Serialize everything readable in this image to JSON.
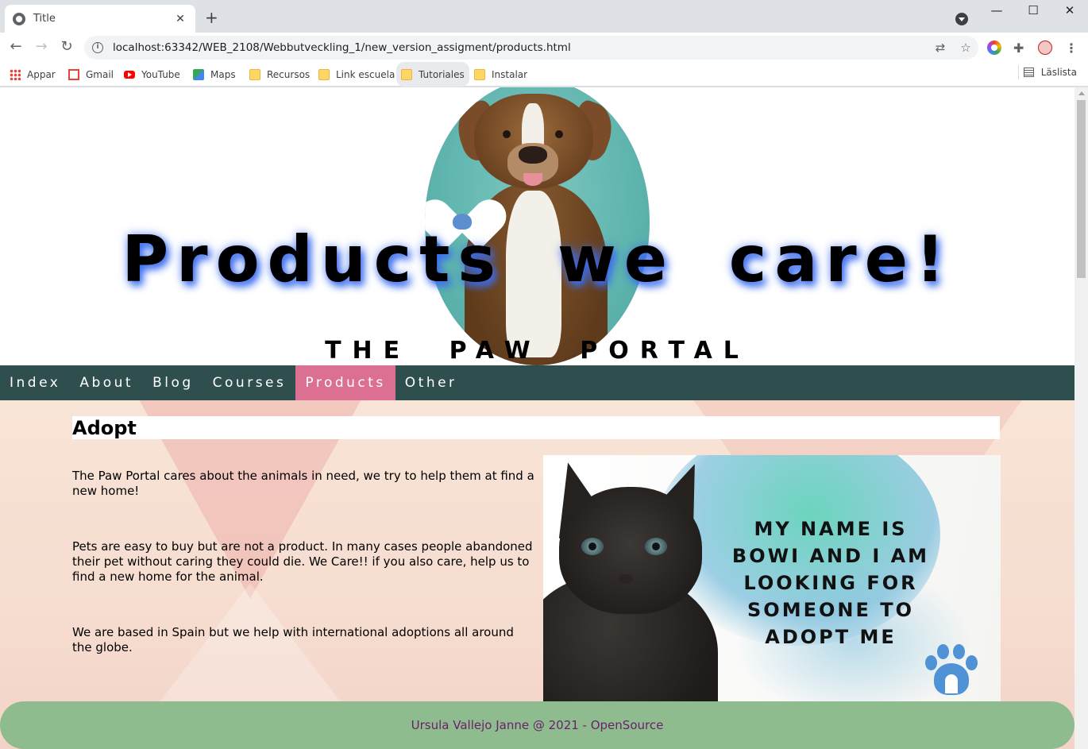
{
  "browser": {
    "tab_title": "Title",
    "new_tab": "+",
    "tab_close": "✕",
    "url": "localhost:63342/WEB_2108/Webbutveckling_1/new_version_assigment/products.html",
    "window_controls": {
      "minimize": "—",
      "maximize": "☐",
      "close": "✕"
    },
    "nav": {
      "back": "←",
      "forward": "→",
      "reload": "↻"
    }
  },
  "bookmarks": {
    "items": [
      {
        "label": "Appar",
        "icon": "apps-grid-icon"
      },
      {
        "label": "Gmail",
        "icon": "gmail-icon"
      },
      {
        "label": "YouTube",
        "icon": "youtube-icon"
      },
      {
        "label": "Maps",
        "icon": "maps-icon"
      },
      {
        "label": "Recursos",
        "icon": "folder-icon"
      },
      {
        "label": "Link escuela",
        "icon": "folder-icon"
      },
      {
        "label": "Tutoriales",
        "icon": "folder-icon"
      },
      {
        "label": "Instalar",
        "icon": "folder-icon"
      }
    ],
    "reading_list": "Läslista"
  },
  "page": {
    "hero_title": "Products we care!",
    "hero_subtitle": "THE PAW PORTAL",
    "nav": {
      "items": [
        "Index",
        "About",
        "Blog",
        "Courses",
        "Products",
        "Other"
      ],
      "active": "Products"
    },
    "section_title": "Adopt",
    "paragraphs": [
      "The Paw Portal cares about the animals in need, we try to help them at find a new home!",
      "Pets are easy to buy but are not a product. In many cases people abandoned their pet without caring they could die. We Care!! if you also care, help us to find a new home for the animal.",
      "We are based in Spain but we help with international adoptions all around the globe."
    ],
    "adopt_card_text": "MY NAME IS BOWI AND I AM LOOKING FOR SOMEONE TO ADOPT ME",
    "footer": "Ursula Vallejo Janne @ 2021 - OpenSource"
  },
  "colors": {
    "nav_bg": "#2f4f4f",
    "nav_active": "#db7093",
    "footer_bg": "#8fbc8f",
    "footer_text": "#6b1f6b",
    "title_glow": "#3a6df0"
  }
}
